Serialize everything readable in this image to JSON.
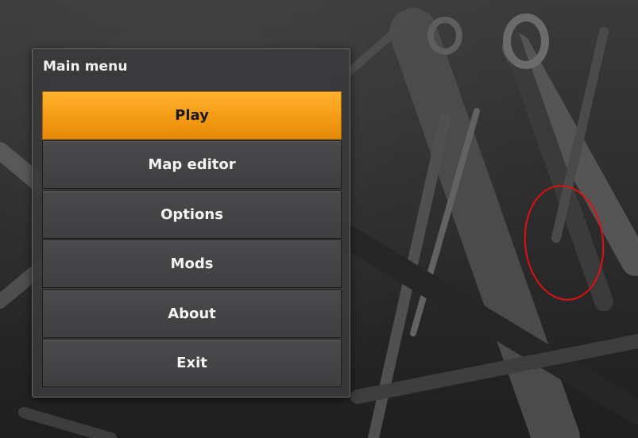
{
  "menu": {
    "title": "Main menu",
    "buttons": [
      {
        "label": "Play",
        "selected": true
      },
      {
        "label": "Map editor",
        "selected": false
      },
      {
        "label": "Options",
        "selected": false
      },
      {
        "label": "Mods",
        "selected": false
      },
      {
        "label": "About",
        "selected": false
      },
      {
        "label": "Exit",
        "selected": false
      }
    ]
  },
  "colors": {
    "accent": "#f7a11c",
    "panel": "#3a3a3c",
    "annotation": "#e01010"
  }
}
